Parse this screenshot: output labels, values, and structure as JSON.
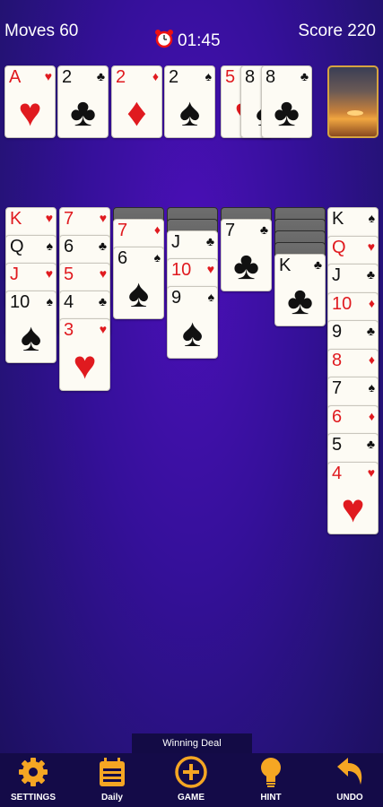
{
  "header": {
    "moves": "Moves 60",
    "timer": "01:45",
    "score": "Score 220"
  },
  "foundations": [
    {
      "rank": "A",
      "suit": "♥",
      "color": "red"
    },
    {
      "rank": "2",
      "suit": "♣",
      "color": "black"
    },
    {
      "rank": "2",
      "suit": "♦",
      "color": "red"
    },
    {
      "rank": "2",
      "suit": "♠",
      "color": "black"
    }
  ],
  "waste": [
    {
      "rank": "5",
      "suit": "♥",
      "color": "red"
    },
    {
      "rank": "8",
      "suit": "♠",
      "color": "black"
    },
    {
      "rank": "8",
      "suit": "♣",
      "color": "black"
    }
  ],
  "columns": [
    {
      "hidden": 0,
      "cards": [
        {
          "rank": "K",
          "suit": "♥",
          "color": "red"
        },
        {
          "rank": "Q",
          "suit": "♠",
          "color": "black"
        },
        {
          "rank": "J",
          "suit": "♥",
          "color": "red"
        },
        {
          "rank": "10",
          "suit": "♠",
          "color": "black"
        }
      ]
    },
    {
      "hidden": 0,
      "cards": [
        {
          "rank": "7",
          "suit": "♥",
          "color": "red"
        },
        {
          "rank": "6",
          "suit": "♣",
          "color": "black"
        },
        {
          "rank": "5",
          "suit": "♥",
          "color": "red"
        },
        {
          "rank": "4",
          "suit": "♣",
          "color": "black"
        },
        {
          "rank": "3",
          "suit": "♥",
          "color": "red"
        }
      ]
    },
    {
      "hidden": 1,
      "cards": [
        {
          "rank": "7",
          "suit": "♦",
          "color": "red"
        },
        {
          "rank": "6",
          "suit": "♠",
          "color": "black"
        }
      ]
    },
    {
      "hidden": 2,
      "cards": [
        {
          "rank": "J",
          "suit": "♣",
          "color": "black"
        },
        {
          "rank": "10",
          "suit": "♥",
          "color": "red"
        },
        {
          "rank": "9",
          "suit": "♠",
          "color": "black"
        }
      ]
    },
    {
      "hidden": 1,
      "cards": [
        {
          "rank": "7",
          "suit": "♣",
          "color": "black"
        }
      ]
    },
    {
      "hidden": 4,
      "cards": [
        {
          "rank": "K",
          "suit": "♣",
          "color": "black"
        }
      ]
    },
    {
      "hidden": 0,
      "cards": [
        {
          "rank": "K",
          "suit": "♠",
          "color": "black"
        },
        {
          "rank": "Q",
          "suit": "♥",
          "color": "red"
        },
        {
          "rank": "J",
          "suit": "♣",
          "color": "black"
        },
        {
          "rank": "10",
          "suit": "♦",
          "color": "red"
        },
        {
          "rank": "9",
          "suit": "♣",
          "color": "black"
        },
        {
          "rank": "8",
          "suit": "♦",
          "color": "red"
        },
        {
          "rank": "7",
          "suit": "♠",
          "color": "black"
        },
        {
          "rank": "6",
          "suit": "♦",
          "color": "red"
        },
        {
          "rank": "5",
          "suit": "♣",
          "color": "black"
        },
        {
          "rank": "4",
          "suit": "♥",
          "color": "red"
        }
      ]
    }
  ],
  "winning_deal": "Winning Deal",
  "footer": [
    {
      "label": "SETTINGS",
      "icon": "gear-icon"
    },
    {
      "label": "Daily",
      "icon": "calendar-icon"
    },
    {
      "label": "GAME",
      "icon": "plus-circle-icon"
    },
    {
      "label": "HINT",
      "icon": "lightbulb-icon"
    },
    {
      "label": "UNDO",
      "icon": "undo-icon"
    }
  ]
}
